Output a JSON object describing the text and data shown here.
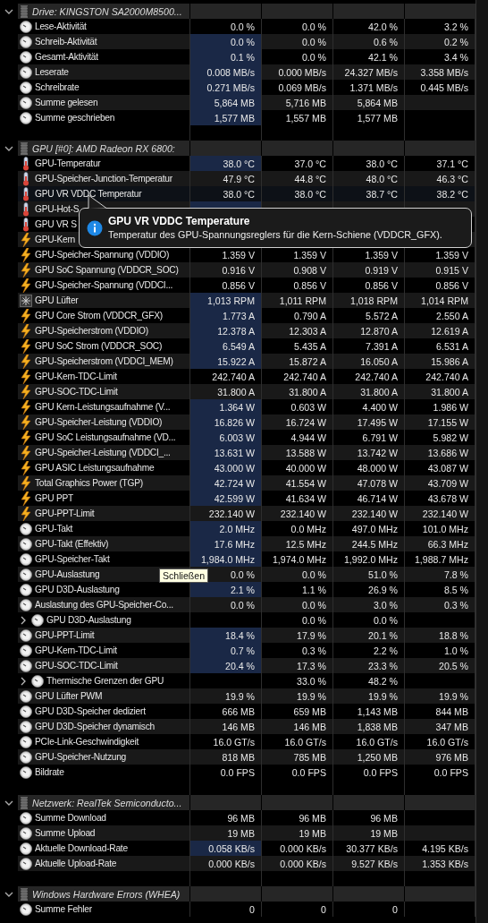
{
  "sections": [
    {
      "title": "Drive: KINGSTON SA2000M8500...",
      "expanded": true,
      "rows": [
        {
          "kind": "gauge",
          "name": "Lese-Aktivität",
          "highlighted": false,
          "hovered": false,
          "column_1": "0.0 %",
          "column_2": "0.0 %",
          "column_3": "42.0 %",
          "column_4": "3.2 %"
        },
        {
          "kind": "gauge",
          "name": "Schreib-Aktivität",
          "highlighted": true,
          "hovered": false,
          "column_1": "0.0 %",
          "column_2": "0.0 %",
          "column_3": "0.6 %",
          "column_4": "0.2 %"
        },
        {
          "kind": "gauge",
          "name": "Gesamt-Aktivität",
          "highlighted": true,
          "hovered": false,
          "column_1": "0.1 %",
          "column_2": "0.0 %",
          "column_3": "42.1 %",
          "column_4": "3.4 %"
        },
        {
          "kind": "gauge",
          "name": "Leserate",
          "highlighted": true,
          "hovered": false,
          "column_1": "0.008 MB/s",
          "column_2": "0.000 MB/s",
          "column_3": "24.327 MB/s",
          "column_4": "3.358 MB/s"
        },
        {
          "kind": "gauge",
          "name": "Schreibrate",
          "highlighted": true,
          "hovered": false,
          "column_1": "0.271 MB/s",
          "column_2": "0.069 MB/s",
          "column_3": "1.371 MB/s",
          "column_4": "0.445 MB/s"
        },
        {
          "kind": "gauge",
          "name": "Summe gelesen",
          "highlighted": true,
          "hovered": false,
          "column_1": "5,864 MB",
          "column_2": "5,716 MB",
          "column_3": "5,864 MB"
        },
        {
          "kind": "gauge",
          "name": "Summe geschrieben",
          "highlighted": true,
          "hovered": false,
          "column_1": "1,577 MB",
          "column_2": "1,557 MB",
          "column_3": "1,577 MB"
        }
      ]
    },
    {
      "title": "GPU [#0]: AMD Radeon RX 6800:",
      "expanded": true,
      "rows": [
        {
          "kind": "thermometer",
          "name": "GPU-Temperatur",
          "highlighted": true,
          "hovered": false,
          "column_1": "38.0 °C",
          "column_2": "37.0 °C",
          "column_3": "38.0 °C",
          "column_4": "37.1 °C"
        },
        {
          "kind": "thermometer",
          "name": "GPU-Speicher-Junction-Temperatur",
          "highlighted": false,
          "hovered": false,
          "column_1": "47.9 °C",
          "column_2": "44.8 °C",
          "column_3": "48.0 °C",
          "column_4": "46.3 °C"
        },
        {
          "kind": "thermometer",
          "name": "GPU VR VDDC Temperatur",
          "highlighted": false,
          "hovered": true,
          "column_1": "38.0 °C",
          "column_2": "38.0 °C",
          "column_3": "38.7 °C",
          "column_4": "38.2 °C"
        },
        {
          "kind": "thermometer",
          "name": "GPU-Hot-S",
          "highlighted": true,
          "hovered": false
        },
        {
          "kind": "thermometer",
          "name": "GPU VR S",
          "highlighted": false,
          "hovered": false
        },
        {
          "kind": "bolt",
          "name": "GPU-Kern",
          "highlighted": false,
          "hovered": false
        },
        {
          "kind": "bolt",
          "name": "GPU-Speicher-Spannung (VDDIO)",
          "highlighted": false,
          "hovered": false,
          "column_1": "1.359 V",
          "column_2": "1.359 V",
          "column_3": "1.359 V",
          "column_4": "1.359 V"
        },
        {
          "kind": "bolt",
          "name": "GPU SoC Spannung (VDDCR_SOC)",
          "highlighted": false,
          "hovered": false,
          "column_1": "0.916 V",
          "column_2": "0.908 V",
          "column_3": "0.919 V",
          "column_4": "0.915 V"
        },
        {
          "kind": "bolt",
          "name": "GPU-Speicher-Spannung (VDDCI...",
          "highlighted": false,
          "hovered": false,
          "column_1": "0.856 V",
          "column_2": "0.856 V",
          "column_3": "0.856 V",
          "column_4": "0.856 V"
        },
        {
          "kind": "fan",
          "name": "GPU Lüfter",
          "highlighted": true,
          "hovered": false,
          "column_1": "1,013 RPM",
          "column_2": "1,011 RPM",
          "column_3": "1,018 RPM",
          "column_4": "1,014 RPM"
        },
        {
          "kind": "bolt",
          "name": "GPU Core Strom (VDDCR_GFX)",
          "highlighted": true,
          "hovered": false,
          "column_1": "1.773 A",
          "column_2": "0.790 A",
          "column_3": "5.572 A",
          "column_4": "2.550 A"
        },
        {
          "kind": "bolt",
          "name": "GPU-Speicherstrom (VDDIO)",
          "highlighted": true,
          "hovered": false,
          "column_1": "12.378 A",
          "column_2": "12.303 A",
          "column_3": "12.870 A",
          "column_4": "12.619 A"
        },
        {
          "kind": "bolt",
          "name": "GPU SoC Strom (VDDCR_SOC)",
          "highlighted": true,
          "hovered": false,
          "column_1": "6.549 A",
          "column_2": "5.435 A",
          "column_3": "7.391 A",
          "column_4": "6.531 A"
        },
        {
          "kind": "bolt",
          "name": "GPU-Speicherstrom (VDDCI_MEM)",
          "highlighted": true,
          "hovered": false,
          "column_1": "15.922 A",
          "column_2": "15.872 A",
          "column_3": "16.050 A",
          "column_4": "15.986 A"
        },
        {
          "kind": "bolt",
          "name": "GPU-Kern-TDC-Limit",
          "highlighted": false,
          "hovered": false,
          "column_1": "242.740 A",
          "column_2": "242.740 A",
          "column_3": "242.740 A",
          "column_4": "242.740 A"
        },
        {
          "kind": "bolt",
          "name": "GPU-SOC-TDC-Limit",
          "highlighted": false,
          "hovered": false,
          "column_1": "31.800 A",
          "column_2": "31.800 A",
          "column_3": "31.800 A",
          "column_4": "31.800 A"
        },
        {
          "kind": "bolt",
          "name": "GPU Kern-Leistungsaufnahme (V...",
          "highlighted": true,
          "hovered": false,
          "column_1": "1.364 W",
          "column_2": "0.603 W",
          "column_3": "4.400 W",
          "column_4": "1.986 W"
        },
        {
          "kind": "bolt",
          "name": "GPU-Speicher-Leistung (VDDIO)",
          "highlighted": true,
          "hovered": false,
          "column_1": "16.826 W",
          "column_2": "16.724 W",
          "column_3": "17.495 W",
          "column_4": "17.155 W"
        },
        {
          "kind": "bolt",
          "name": "GPU SoC Leistungsaufnahme (VD...",
          "highlighted": true,
          "hovered": false,
          "column_1": "6.003 W",
          "column_2": "4.944 W",
          "column_3": "6.791 W",
          "column_4": "5.982 W"
        },
        {
          "kind": "bolt",
          "name": "GPU-Speicher-Leistung (VDDCI_...",
          "highlighted": true,
          "hovered": false,
          "column_1": "13.631 W",
          "column_2": "13.588 W",
          "column_3": "13.742 W",
          "column_4": "13.686 W"
        },
        {
          "kind": "bolt",
          "name": "GPU ASIC Leistungsaufnahme",
          "highlighted": true,
          "hovered": false,
          "column_1": "43.000 W",
          "column_2": "40.000 W",
          "column_3": "48.000 W",
          "column_4": "43.087 W"
        },
        {
          "kind": "bolt",
          "name": "Total Graphics Power (TGP)",
          "highlighted": true,
          "hovered": false,
          "column_1": "42.724 W",
          "column_2": "41.554 W",
          "column_3": "47.078 W",
          "column_4": "43.709 W"
        },
        {
          "kind": "bolt",
          "name": "GPU PPT",
          "highlighted": true,
          "hovered": false,
          "column_1": "42.599 W",
          "column_2": "41.634 W",
          "column_3": "46.714 W",
          "column_4": "43.678 W"
        },
        {
          "kind": "bolt",
          "name": "GPU-PPT-Limit",
          "highlighted": false,
          "hovered": false,
          "column_1": "232.140 W",
          "column_2": "232.140 W",
          "column_3": "232.140 W",
          "column_4": "232.140 W"
        },
        {
          "kind": "gauge",
          "name": "GPU-Takt",
          "highlighted": true,
          "hovered": false,
          "column_1": "2.0 MHz",
          "column_2": "0.0 MHz",
          "column_3": "497.0 MHz",
          "column_4": "101.0 MHz"
        },
        {
          "kind": "gauge",
          "name": "GPU-Takt (Effektiv)",
          "highlighted": true,
          "hovered": false,
          "column_1": "17.6 MHz",
          "column_2": "12.5 MHz",
          "column_3": "244.5 MHz",
          "column_4": "66.3 MHz"
        },
        {
          "kind": "gauge",
          "name": "GPU-Speicher-Takt",
          "highlighted": true,
          "hovered": false,
          "column_1": "1,984.0 MHz",
          "column_2": "1,974.0 MHz",
          "column_3": "1,992.0 MHz",
          "column_4": "1,988.7 MHz"
        },
        {
          "kind": "gauge",
          "name": "GPU-Auslastung",
          "highlighted": false,
          "hovered": false,
          "column_1": "0.0 %",
          "column_2": "0.0 %",
          "column_3": "51.0 %",
          "column_4": "7.8 %"
        },
        {
          "kind": "gauge",
          "name": "GPU D3D-Auslastung",
          "highlighted": true,
          "hovered": false,
          "column_1": "2.1 %",
          "column_2": "1.1 %",
          "column_3": "26.9 %",
          "column_4": "8.5 %"
        },
        {
          "kind": "gauge",
          "name": "Auslastung des GPU-Speicher-Co...",
          "highlighted": false,
          "hovered": false,
          "column_1": "0.0 %",
          "column_2": "0.0 %",
          "column_3": "3.0 %",
          "column_4": "0.3 %"
        },
        {
          "kind": "group",
          "name": "GPU D3D-Auslastung",
          "highlighted": false,
          "hovered": false,
          "column_2": "0.0 %",
          "column_3": "0.0 %"
        },
        {
          "kind": "gauge",
          "name": "GPU-PPT-Limit",
          "highlighted": true,
          "hovered": false,
          "column_1": "18.4 %",
          "column_2": "17.9 %",
          "column_3": "20.1 %",
          "column_4": "18.8 %"
        },
        {
          "kind": "gauge",
          "name": "GPU-Kern-TDC-Limit",
          "highlighted": true,
          "hovered": false,
          "column_1": "0.7 %",
          "column_2": "0.3 %",
          "column_3": "2.2 %",
          "column_4": "1.0 %"
        },
        {
          "kind": "gauge",
          "name": "GPU-SOC-TDC-Limit",
          "highlighted": true,
          "hovered": false,
          "column_1": "20.4 %",
          "column_2": "17.3 %",
          "column_3": "23.3 %",
          "column_4": "20.5 %"
        },
        {
          "kind": "group",
          "name": "Thermische Grenzen der GPU",
          "highlighted": false,
          "hovered": false,
          "column_2": "33.0 %",
          "column_3": "48.2 %"
        },
        {
          "kind": "gauge",
          "name": "GPU Lüfter PWM",
          "highlighted": false,
          "hovered": false,
          "column_1": "19.9 %",
          "column_2": "19.9 %",
          "column_3": "19.9 %",
          "column_4": "19.9 %"
        },
        {
          "kind": "gauge",
          "name": "GPU D3D-Speicher dediziert",
          "highlighted": false,
          "hovered": false,
          "column_1": "666 MB",
          "column_2": "659 MB",
          "column_3": "1,143 MB",
          "column_4": "844 MB"
        },
        {
          "kind": "gauge",
          "name": "GPU D3D-Speicher dynamisch",
          "highlighted": false,
          "hovered": false,
          "column_1": "146 MB",
          "column_2": "146 MB",
          "column_3": "1,838 MB",
          "column_4": "347 MB"
        },
        {
          "kind": "gauge",
          "name": "PCIe-Link-Geschwindigkeit",
          "highlighted": false,
          "hovered": false,
          "column_1": "16.0 GT/s",
          "column_2": "16.0 GT/s",
          "column_3": "16.0 GT/s",
          "column_4": "16.0 GT/s"
        },
        {
          "kind": "gauge",
          "name": "GPU-Speicher-Nutzung",
          "highlighted": false,
          "hovered": false,
          "column_1": "818 MB",
          "column_2": "785 MB",
          "column_3": "1,250 MB",
          "column_4": "976 MB"
        },
        {
          "kind": "gauge",
          "name": "Bildrate",
          "highlighted": false,
          "hovered": false,
          "column_1": "0.0 FPS",
          "column_2": "0.0 FPS",
          "column_3": "0.0 FPS",
          "column_4": "0.0 FPS"
        }
      ]
    },
    {
      "title": "Netzwerk: RealTek Semiconducto...",
      "expanded": true,
      "rows": [
        {
          "kind": "gauge",
          "name": "Summe Download",
          "highlighted": false,
          "hovered": false,
          "column_1": "96 MB",
          "column_2": "96 MB",
          "column_3": "96 MB"
        },
        {
          "kind": "gauge",
          "name": "Summe Upload",
          "highlighted": false,
          "hovered": false,
          "column_1": "19 MB",
          "column_2": "19 MB",
          "column_3": "19 MB"
        },
        {
          "kind": "gauge",
          "name": "Aktuelle Download-Rate",
          "highlighted": true,
          "hovered": false,
          "column_1": "0.058 KB/s",
          "column_2": "0.000 KB/s",
          "column_3": "30.377 KB/s",
          "column_4": "4.195 KB/s"
        },
        {
          "kind": "gauge",
          "name": "Aktuelle Upload-Rate",
          "highlighted": false,
          "hovered": false,
          "column_1": "0.000 KB/s",
          "column_2": "0.000 KB/s",
          "column_3": "9.527 KB/s",
          "column_4": "1.353 KB/s"
        }
      ]
    },
    {
      "title": "Windows Hardware Errors (WHEA)",
      "expanded": true,
      "rows": [
        {
          "kind": "gauge",
          "name": "Summe Fehler",
          "highlighted": false,
          "hovered": false,
          "column_1": "0",
          "column_2": "0",
          "column_3": "0"
        }
      ]
    }
  ],
  "tooltip": {
    "title": "GPU VR VDDC Temperature",
    "text": "Temperatur des GPU-Spannungsreglers für die Kern-Schiene (VDDCR_GFX)."
  },
  "close_tooltip": {
    "text": "Schließen"
  }
}
